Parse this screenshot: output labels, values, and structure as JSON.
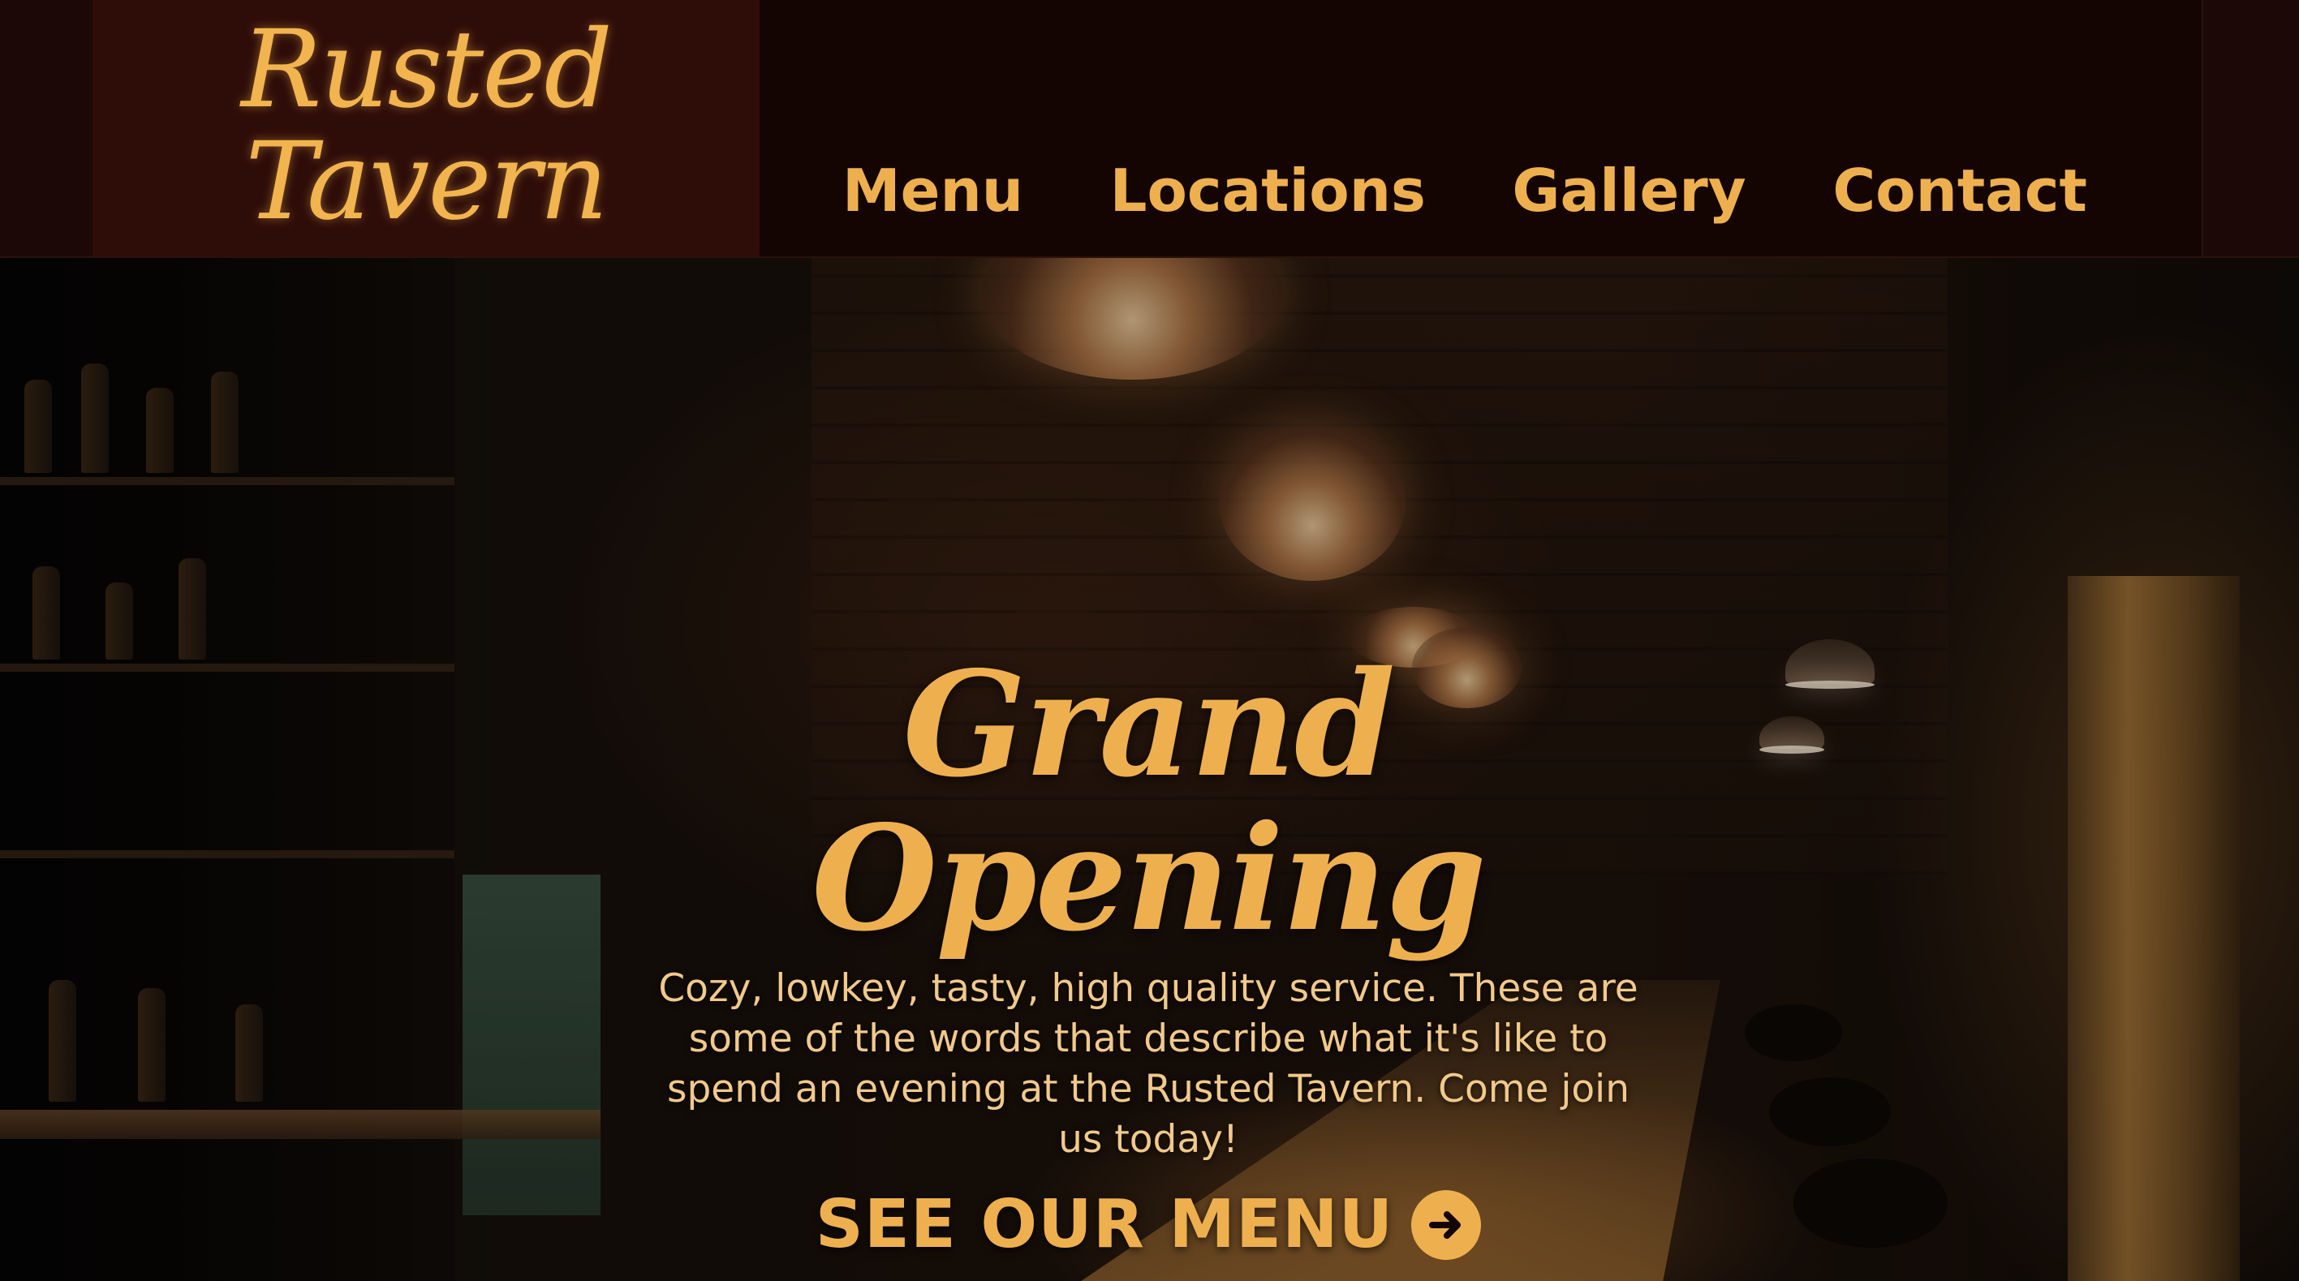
{
  "brand": {
    "logo_line1": "Rusted",
    "logo_line2": "Tavern"
  },
  "nav": {
    "items": [
      {
        "label": "Menu"
      },
      {
        "label": "Locations"
      },
      {
        "label": "Gallery"
      },
      {
        "label": "Contact"
      }
    ]
  },
  "hero": {
    "title": "Grand Opening",
    "description": "Cozy, lowkey, tasty, high quality service. These are some of the words that describe what it's like to spend an evening at the Rusted Tavern. Come join us today!",
    "cta_label": "SEE OUR MENU",
    "cta_icon": "arrow-right-circle-icon"
  },
  "colors": {
    "accent": "#eeb04f",
    "header_bg": "#140503",
    "logo_bg": "#2e0d09"
  }
}
